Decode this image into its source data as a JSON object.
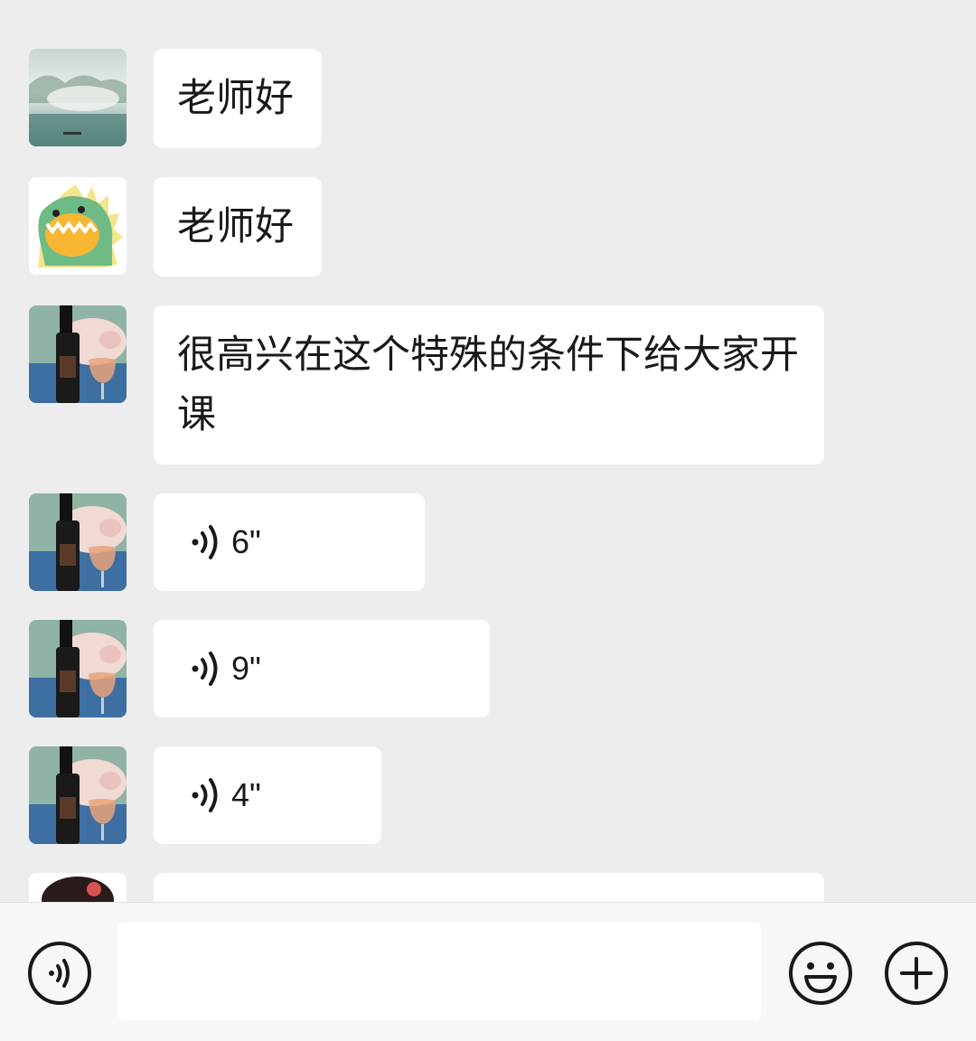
{
  "chat": {
    "messages": [
      {
        "type": "text",
        "avatar": "misty-lake-photo",
        "text": "老师好"
      },
      {
        "type": "text",
        "avatar": "green-dinosaur-cartoon",
        "text": "老师好"
      },
      {
        "type": "text",
        "avatar": "pig-with-wine-photo",
        "text": "很高兴在这个特殊的条件下给大家开课"
      },
      {
        "type": "voice",
        "avatar": "pig-with-wine-photo",
        "duration": "6\""
      },
      {
        "type": "voice",
        "avatar": "pig-with-wine-photo",
        "duration": "9\""
      },
      {
        "type": "voice",
        "avatar": "pig-with-wine-photo",
        "duration": "4\""
      },
      {
        "type": "text",
        "avatar": "cartoon-girl-dark-hair",
        "text": ""
      }
    ]
  },
  "composer": {
    "left_icon": "voice-input-icon",
    "input_value": "",
    "right_icons": [
      "emoji-icon",
      "plus-icon"
    ]
  },
  "colors": {
    "background": "#ededed",
    "bubble": "#ffffff",
    "text": "#191919",
    "composer": "#f7f7f7"
  }
}
